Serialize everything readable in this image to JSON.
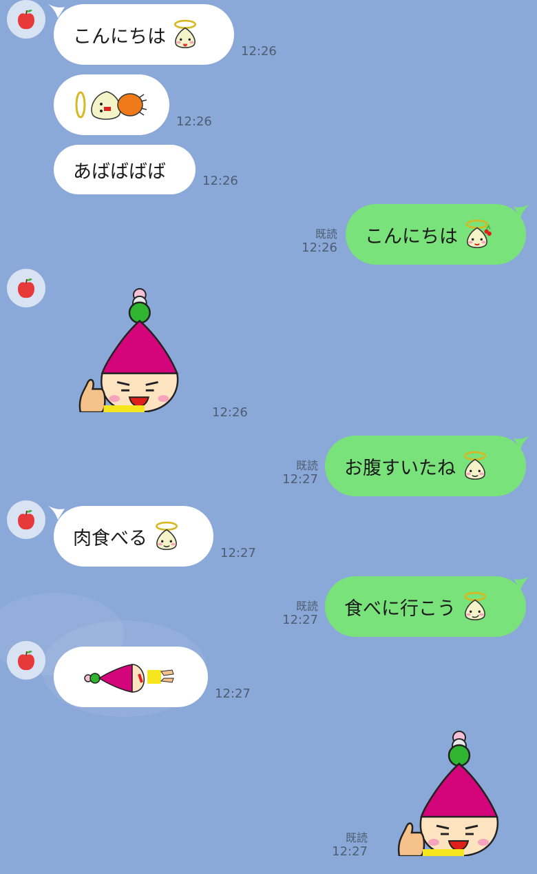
{
  "chat": {
    "messages": [
      {
        "side": "in",
        "type": "text",
        "text": "こんにちは",
        "emoji": "angel-tongue-emoji",
        "time": "12:26"
      },
      {
        "side": "in",
        "type": "sticker",
        "sticker": "angel-chick-orange-sticker",
        "time": "12:26"
      },
      {
        "side": "in",
        "type": "text",
        "text": "あばばばば",
        "time": "12:26"
      },
      {
        "side": "out",
        "type": "text",
        "text": "こんにちは",
        "emoji": "angel-cherry-emoji",
        "read": "既読",
        "time": "12:26"
      },
      {
        "side": "in",
        "type": "sticker",
        "sticker": "pink-hat-thumbs-up-sticker",
        "time": "12:26"
      },
      {
        "side": "out",
        "type": "text",
        "text": "お腹すいたね",
        "emoji": "angel-drool-emoji",
        "read": "既読",
        "time": "12:27"
      },
      {
        "side": "in",
        "type": "text",
        "text": "肉食べる",
        "emoji": "angel-drool-emoji",
        "time": "12:27"
      },
      {
        "side": "out",
        "type": "text",
        "text": "食べに行こう",
        "emoji": "angel-smirk-emoji",
        "read": "既読",
        "time": "12:27"
      },
      {
        "side": "in",
        "type": "sticker",
        "sticker": "pink-hat-lying-sticker",
        "time": "12:27"
      },
      {
        "side": "out",
        "type": "sticker",
        "sticker": "pink-hat-thumbs-up-sticker",
        "read": "既読",
        "time": "12:27"
      }
    ]
  },
  "colors": {
    "background": "#8aa8d8",
    "incoming_bubble": "#ffffff",
    "outgoing_bubble": "#79e27b",
    "meta_text": "#4e5d70"
  },
  "icons": {
    "avatar": "apple-icon"
  }
}
